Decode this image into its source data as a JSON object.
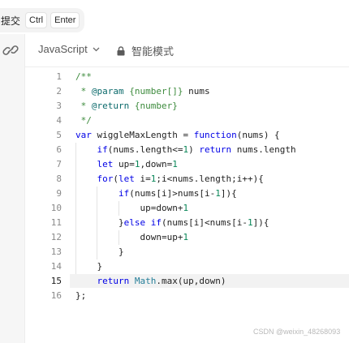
{
  "shortcut": {
    "label": "提交",
    "keys": [
      "Ctrl",
      "Enter"
    ]
  },
  "toolbar": {
    "language": "JavaScript",
    "mode": "智能模式"
  },
  "editor": {
    "active_line": 15,
    "line_numbers": [
      "1",
      "2",
      "3",
      "4",
      "5",
      "6",
      "7",
      "8",
      "9",
      "10",
      "11",
      "12",
      "13",
      "14",
      "15",
      "16"
    ],
    "lines": [
      [
        {
          "t": "/**",
          "k": "c"
        }
      ],
      [
        {
          "t": " * ",
          "k": "c"
        },
        {
          "t": "@param",
          "k": "tg"
        },
        {
          "t": " {number[]} ",
          "k": "c"
        },
        {
          "t": "nums",
          "k": ""
        }
      ],
      [
        {
          "t": " * ",
          "k": "c"
        },
        {
          "t": "@return",
          "k": "tg"
        },
        {
          "t": " {number}",
          "k": "c"
        }
      ],
      [
        {
          "t": " */",
          "k": "c"
        }
      ],
      [
        {
          "t": "var ",
          "k": "kw"
        },
        {
          "t": "wiggleMaxLength = ",
          "k": ""
        },
        {
          "t": "function",
          "k": "kw"
        },
        {
          "t": "(nums) {",
          "k": ""
        }
      ],
      [
        {
          "t": "    ",
          "k": ""
        },
        {
          "t": "if",
          "k": "kw"
        },
        {
          "t": "(nums.length<=",
          "k": ""
        },
        {
          "t": "1",
          "k": "nm"
        },
        {
          "t": ") ",
          "k": ""
        },
        {
          "t": "return",
          "k": "kw"
        },
        {
          "t": " nums.length",
          "k": ""
        }
      ],
      [
        {
          "t": "    ",
          "k": ""
        },
        {
          "t": "let",
          "k": "kw"
        },
        {
          "t": " up=",
          "k": ""
        },
        {
          "t": "1",
          "k": "nm"
        },
        {
          "t": ",down=",
          "k": ""
        },
        {
          "t": "1",
          "k": "nm"
        }
      ],
      [
        {
          "t": "    ",
          "k": ""
        },
        {
          "t": "for",
          "k": "kw"
        },
        {
          "t": "(",
          "k": ""
        },
        {
          "t": "let",
          "k": "kw"
        },
        {
          "t": " i=",
          "k": ""
        },
        {
          "t": "1",
          "k": "nm"
        },
        {
          "t": ";i<nums.length;i++){",
          "k": ""
        }
      ],
      [
        {
          "t": "        ",
          "k": ""
        },
        {
          "t": "if",
          "k": "kw"
        },
        {
          "t": "(nums[i]>nums[i-",
          "k": ""
        },
        {
          "t": "1",
          "k": "nm"
        },
        {
          "t": "]){",
          "k": ""
        }
      ],
      [
        {
          "t": "            up=down+",
          "k": ""
        },
        {
          "t": "1",
          "k": "nm"
        }
      ],
      [
        {
          "t": "        }",
          "k": ""
        },
        {
          "t": "else",
          "k": "kw"
        },
        {
          "t": " ",
          "k": ""
        },
        {
          "t": "if",
          "k": "kw"
        },
        {
          "t": "(nums[i]<nums[i-",
          "k": ""
        },
        {
          "t": "1",
          "k": "nm"
        },
        {
          "t": "]){",
          "k": ""
        }
      ],
      [
        {
          "t": "            down=up+",
          "k": ""
        },
        {
          "t": "1",
          "k": "nm"
        }
      ],
      [
        {
          "t": "        }",
          "k": ""
        }
      ],
      [
        {
          "t": "    }",
          "k": ""
        }
      ],
      [
        {
          "t": "    ",
          "k": ""
        },
        {
          "t": "return",
          "k": "kw"
        },
        {
          "t": " ",
          "k": ""
        },
        {
          "t": "Math",
          "k": "cl"
        },
        {
          "t": ".max(up,down)",
          "k": ""
        }
      ],
      [
        {
          "t": "};",
          "k": ""
        }
      ]
    ]
  },
  "watermark": "CSDN @weixin_48268093",
  "icons": {
    "link": "link-icon",
    "chevron": "chevron-down-icon",
    "lock": "lock-icon"
  }
}
